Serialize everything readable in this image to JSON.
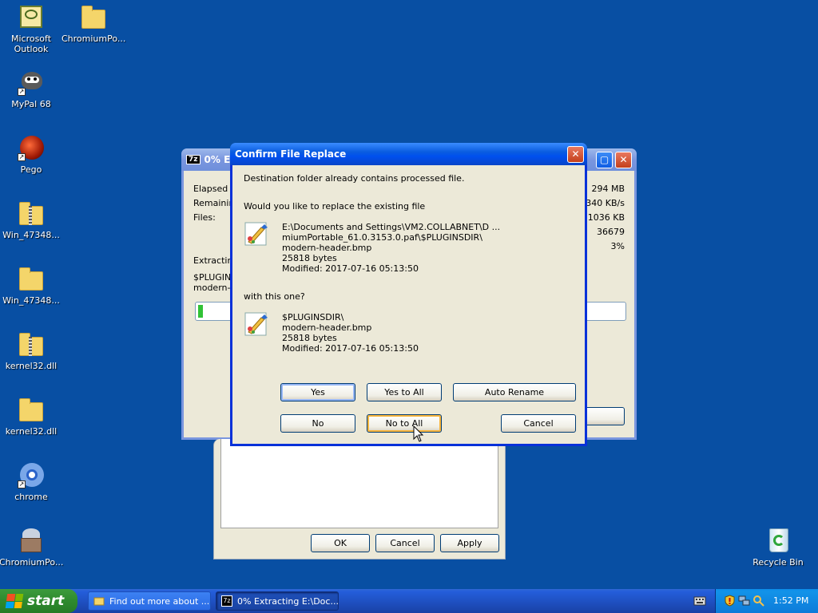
{
  "desktop": {
    "icons": [
      {
        "label": "Microsoft Outlook",
        "icon": "outlook-icon"
      },
      {
        "label": "ChromiumPo...",
        "icon": "folder-icon"
      },
      {
        "label": "MyPal 68",
        "icon": "mypal-icon"
      },
      {
        "label": "Pego",
        "icon": "pego-icon"
      },
      {
        "label": "Win_47348...",
        "icon": "zip-folder-icon"
      },
      {
        "label": "Win_47348...",
        "icon": "folder-icon"
      },
      {
        "label": "kernel32.dll",
        "icon": "zip-folder-icon"
      },
      {
        "label": "kernel32.dll",
        "icon": "folder-icon"
      },
      {
        "label": "chrome",
        "icon": "chrome-icon"
      },
      {
        "label": "ChromiumPo...",
        "icon": "chromium-portable-icon"
      },
      {
        "label": "Recycle Bin",
        "icon": "recycle-bin-icon"
      }
    ]
  },
  "progress_window": {
    "title": "0% Ex",
    "title_icon": "7z",
    "labels": {
      "elapsed": "Elapsed t",
      "remaining": "Remainin",
      "files": "Files:",
      "extracting": "Extracting",
      "path1": "$PLUGIN",
      "path2": "modern-h"
    },
    "values": {
      "size": "294 MB",
      "speed": "340 KB/s",
      "processed": "1036 KB",
      "count": "36679",
      "percent": "3%"
    },
    "progress_fraction": 0.01
  },
  "properties_window": {
    "ok": "OK",
    "cancel": "Cancel",
    "apply": "Apply"
  },
  "confirm_dialog": {
    "title": "Confirm File Replace",
    "line1": "Destination folder already contains processed file.",
    "line2": "Would you like to replace the existing file",
    "existing": {
      "path1": "E:\\Documents and Settings\\VM2.COLLABNET\\D ...",
      "path2": "miumPortable_61.0.3153.0.paf\\$PLUGINSDIR\\",
      "name": "modern-header.bmp",
      "size": "25818 bytes",
      "modified": "Modified: 2017-07-16 05:13:50"
    },
    "with_text": "with this one?",
    "new": {
      "path1": "$PLUGINSDIR\\",
      "name": "modern-header.bmp",
      "size": "25818 bytes",
      "modified": "Modified: 2017-07-16 05:13:50"
    },
    "buttons": {
      "yes": "Yes",
      "yes_to_all": "Yes to All",
      "auto_rename": "Auto Rename",
      "no": "No",
      "no_to_all": "No to All",
      "cancel": "Cancel"
    }
  },
  "taskbar": {
    "start": "start",
    "tasks": [
      {
        "label": "Find out more about ...",
        "active": false
      },
      {
        "label": "0% Extracting E:\\Doc...",
        "active": true
      }
    ],
    "clock": "1:52 PM"
  },
  "colors": {
    "desktop": "#084fa3",
    "title_active": "#0050ee",
    "title_inactive": "#7a96df",
    "face": "#ece9d8",
    "progress": "#31c236"
  }
}
